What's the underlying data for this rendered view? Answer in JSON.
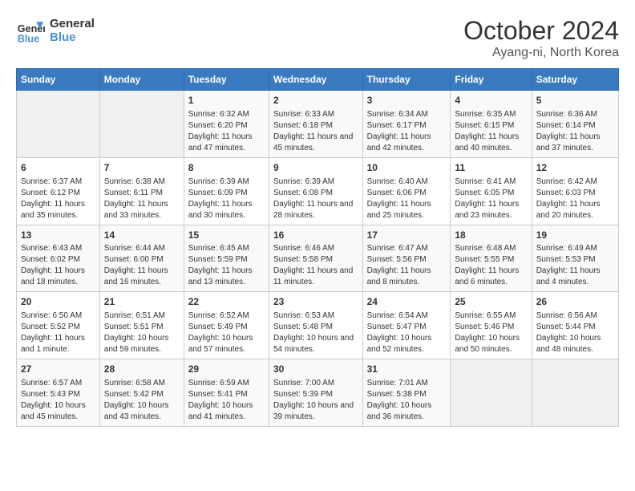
{
  "header": {
    "logo_line1": "General",
    "logo_line2": "Blue",
    "title": "October 2024",
    "subtitle": "Ayang-ni, North Korea"
  },
  "days_of_week": [
    "Sunday",
    "Monday",
    "Tuesday",
    "Wednesday",
    "Thursday",
    "Friday",
    "Saturday"
  ],
  "weeks": [
    [
      {
        "day": "",
        "info": ""
      },
      {
        "day": "",
        "info": ""
      },
      {
        "day": "1",
        "info": "Sunrise: 6:32 AM\nSunset: 6:20 PM\nDaylight: 11 hours and 47 minutes."
      },
      {
        "day": "2",
        "info": "Sunrise: 6:33 AM\nSunset: 6:18 PM\nDaylight: 11 hours and 45 minutes."
      },
      {
        "day": "3",
        "info": "Sunrise: 6:34 AM\nSunset: 6:17 PM\nDaylight: 11 hours and 42 minutes."
      },
      {
        "day": "4",
        "info": "Sunrise: 6:35 AM\nSunset: 6:15 PM\nDaylight: 11 hours and 40 minutes."
      },
      {
        "day": "5",
        "info": "Sunrise: 6:36 AM\nSunset: 6:14 PM\nDaylight: 11 hours and 37 minutes."
      }
    ],
    [
      {
        "day": "6",
        "info": "Sunrise: 6:37 AM\nSunset: 6:12 PM\nDaylight: 11 hours and 35 minutes."
      },
      {
        "day": "7",
        "info": "Sunrise: 6:38 AM\nSunset: 6:11 PM\nDaylight: 11 hours and 33 minutes."
      },
      {
        "day": "8",
        "info": "Sunrise: 6:39 AM\nSunset: 6:09 PM\nDaylight: 11 hours and 30 minutes."
      },
      {
        "day": "9",
        "info": "Sunrise: 6:39 AM\nSunset: 6:08 PM\nDaylight: 11 hours and 28 minutes."
      },
      {
        "day": "10",
        "info": "Sunrise: 6:40 AM\nSunset: 6:06 PM\nDaylight: 11 hours and 25 minutes."
      },
      {
        "day": "11",
        "info": "Sunrise: 6:41 AM\nSunset: 6:05 PM\nDaylight: 11 hours and 23 minutes."
      },
      {
        "day": "12",
        "info": "Sunrise: 6:42 AM\nSunset: 6:03 PM\nDaylight: 11 hours and 20 minutes."
      }
    ],
    [
      {
        "day": "13",
        "info": "Sunrise: 6:43 AM\nSunset: 6:02 PM\nDaylight: 11 hours and 18 minutes."
      },
      {
        "day": "14",
        "info": "Sunrise: 6:44 AM\nSunset: 6:00 PM\nDaylight: 11 hours and 16 minutes."
      },
      {
        "day": "15",
        "info": "Sunrise: 6:45 AM\nSunset: 5:59 PM\nDaylight: 11 hours and 13 minutes."
      },
      {
        "day": "16",
        "info": "Sunrise: 6:46 AM\nSunset: 5:58 PM\nDaylight: 11 hours and 11 minutes."
      },
      {
        "day": "17",
        "info": "Sunrise: 6:47 AM\nSunset: 5:56 PM\nDaylight: 11 hours and 8 minutes."
      },
      {
        "day": "18",
        "info": "Sunrise: 6:48 AM\nSunset: 5:55 PM\nDaylight: 11 hours and 6 minutes."
      },
      {
        "day": "19",
        "info": "Sunrise: 6:49 AM\nSunset: 5:53 PM\nDaylight: 11 hours and 4 minutes."
      }
    ],
    [
      {
        "day": "20",
        "info": "Sunrise: 6:50 AM\nSunset: 5:52 PM\nDaylight: 11 hours and 1 minute."
      },
      {
        "day": "21",
        "info": "Sunrise: 6:51 AM\nSunset: 5:51 PM\nDaylight: 10 hours and 59 minutes."
      },
      {
        "day": "22",
        "info": "Sunrise: 6:52 AM\nSunset: 5:49 PM\nDaylight: 10 hours and 57 minutes."
      },
      {
        "day": "23",
        "info": "Sunrise: 6:53 AM\nSunset: 5:48 PM\nDaylight: 10 hours and 54 minutes."
      },
      {
        "day": "24",
        "info": "Sunrise: 6:54 AM\nSunset: 5:47 PM\nDaylight: 10 hours and 52 minutes."
      },
      {
        "day": "25",
        "info": "Sunrise: 6:55 AM\nSunset: 5:46 PM\nDaylight: 10 hours and 50 minutes."
      },
      {
        "day": "26",
        "info": "Sunrise: 6:56 AM\nSunset: 5:44 PM\nDaylight: 10 hours and 48 minutes."
      }
    ],
    [
      {
        "day": "27",
        "info": "Sunrise: 6:57 AM\nSunset: 5:43 PM\nDaylight: 10 hours and 45 minutes."
      },
      {
        "day": "28",
        "info": "Sunrise: 6:58 AM\nSunset: 5:42 PM\nDaylight: 10 hours and 43 minutes."
      },
      {
        "day": "29",
        "info": "Sunrise: 6:59 AM\nSunset: 5:41 PM\nDaylight: 10 hours and 41 minutes."
      },
      {
        "day": "30",
        "info": "Sunrise: 7:00 AM\nSunset: 5:39 PM\nDaylight: 10 hours and 39 minutes."
      },
      {
        "day": "31",
        "info": "Sunrise: 7:01 AM\nSunset: 5:38 PM\nDaylight: 10 hours and 36 minutes."
      },
      {
        "day": "",
        "info": ""
      },
      {
        "day": "",
        "info": ""
      }
    ]
  ]
}
